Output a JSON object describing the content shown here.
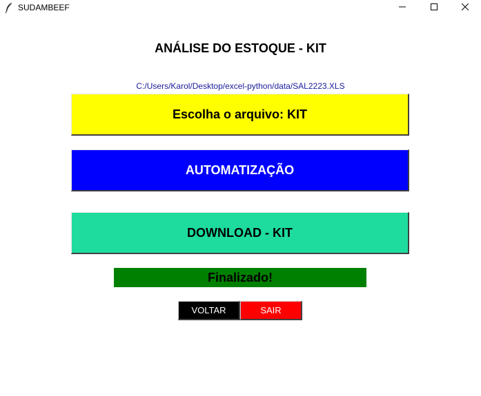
{
  "window": {
    "title": "SUDAMBEEF",
    "icon": "feather-icon"
  },
  "main": {
    "heading": "ANÁLISE DO ESTOQUE - KIT",
    "file_path": "C:/Users/Karol/Desktop/excel-python/data/SAL2223.XLS",
    "choose_file_label": "Escolha o arquivo: KIT",
    "automation_label": "AUTOMATIZAÇÃO",
    "download_label": "DOWNLOAD - KIT",
    "status_text": "Finalizado!",
    "back_label": "VOLTAR",
    "exit_label": "SAIR"
  },
  "colors": {
    "choose_button": "#ffff00",
    "automation_button": "#0000ff",
    "download_button": "#1ddc9e",
    "status_bar": "#008000",
    "back_button": "#000000",
    "exit_button": "#ff0000",
    "file_path_text": "#1a1a9c"
  }
}
